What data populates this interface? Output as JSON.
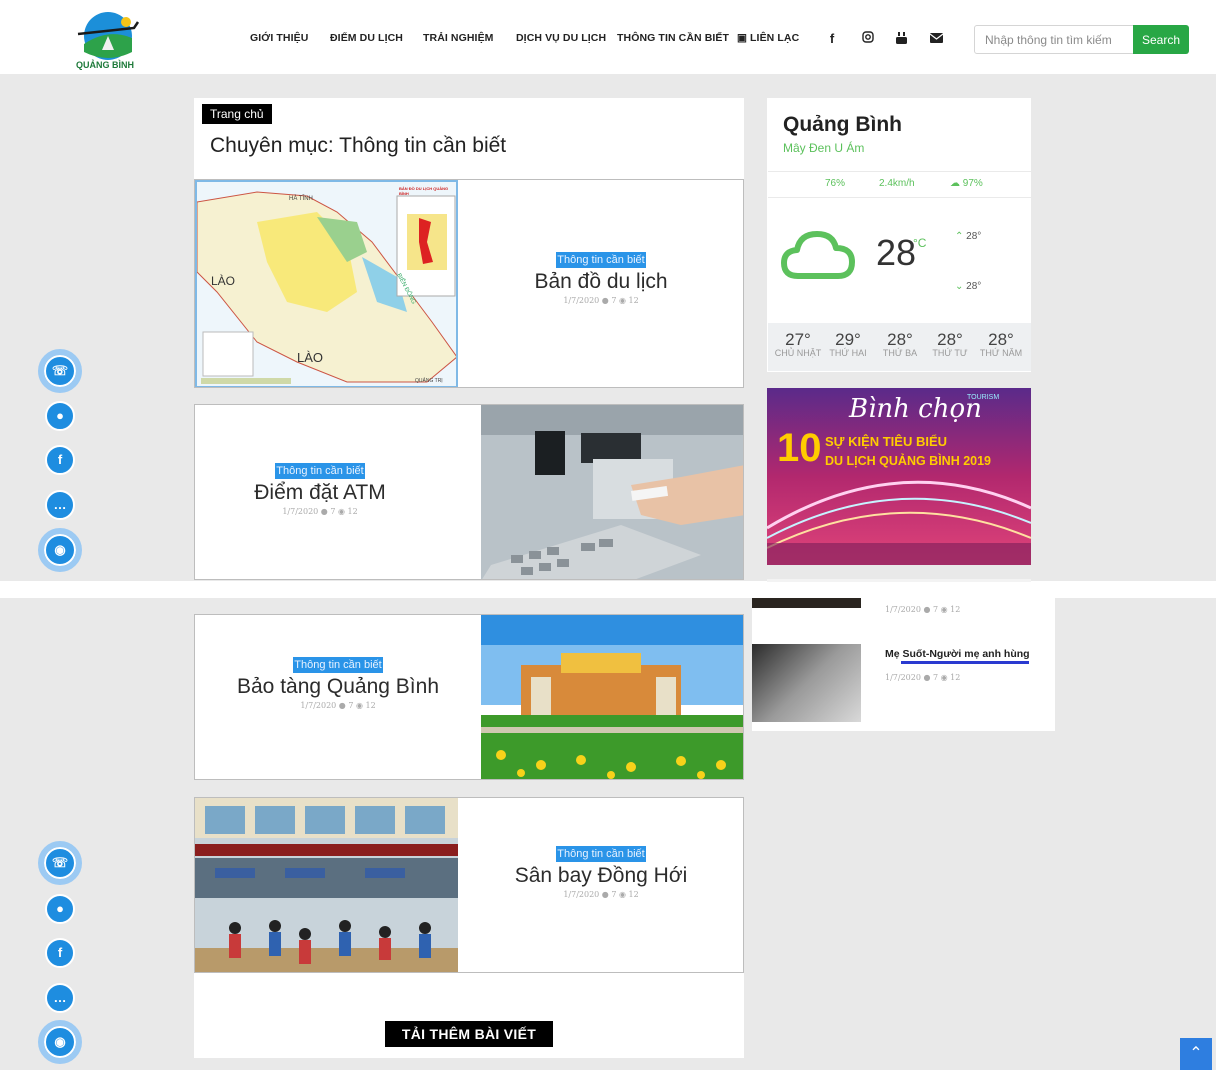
{
  "header": {
    "logo_text": "QUẢNG BÌNH",
    "nav": [
      "GIỚI THIỆU",
      "ĐIỂM DU LỊCH",
      "TRẢI NGHIỆM",
      "DỊCH VỤ DU LỊCH",
      "THÔNG TIN CẦN BIẾT",
      "LIÊN LẠC"
    ],
    "social_icons": [
      "facebook-icon",
      "instagram-icon",
      "youtube-icon",
      "mail-icon"
    ],
    "search_placeholder": "Nhập thông tin tìm kiếm",
    "search_label": "Search"
  },
  "breadcrumb": "Trang chủ",
  "category_title": "Chuyên mục: Thông tin cần biết",
  "articles": [
    {
      "tag": "Thông tin cần biết",
      "title": "Bản đồ du lịch",
      "meta": "1/7/2020 ● 7 ◉ 12"
    },
    {
      "tag": "Thông tin cần biết",
      "title": "Điểm đặt ATM",
      "meta": "1/7/2020 ● 7 ◉ 12"
    },
    {
      "tag": "Thông tin cần biết",
      "title": "Bảo tàng Quảng Bình",
      "meta": "1/7/2020 ● 7 ◉ 12"
    },
    {
      "tag": "Thông tin cần biết",
      "title": "Sân bay Đồng Hới",
      "meta": "1/7/2020 ● 7 ◉ 12"
    }
  ],
  "map_labels": {
    "ha_tinh": "HÀ TĨNH",
    "lao": "LÀO",
    "sea": "BIỂN ĐÔNG",
    "quang_tri": "QUẢNG TRỊ",
    "map_title": "BẢN ĐỒ DU LỊCH QUẢNG BÌNH"
  },
  "load_more": "TẢI THÊM BÀI VIẾT",
  "weather": {
    "city": "Quảng Bình",
    "condition": "Mây Đen U Ám",
    "humidity": "76%",
    "wind": "2.4km/h",
    "cloud": "97%",
    "temp": "28",
    "unit": "°C",
    "high": "28°",
    "low": "28°",
    "forecast": [
      {
        "t": "27°",
        "d": "CHỦ NHẬT"
      },
      {
        "t": "29°",
        "d": "THỨ HAI"
      },
      {
        "t": "28°",
        "d": "THỨ BA"
      },
      {
        "t": "28°",
        "d": "THỨ TƯ"
      },
      {
        "t": "28°",
        "d": "THỨ NĂM"
      }
    ]
  },
  "banner": {
    "line1": "Bình chọn",
    "num": "10",
    "line2": "SỰ KIỆN TIÊU BIỂU",
    "line3": "DU LỊCH QUẢNG BÌNH 2019",
    "logo": "TOURISM"
  },
  "side_posts": [
    {
      "title": "",
      "meta": "1/7/2020 ● 7 ◉ 12"
    },
    {
      "title": "Mẹ Suốt-Người mẹ anh hùng",
      "meta": "1/7/2020 ● 7 ◉ 12"
    }
  ],
  "colors": {
    "accent_green": "#28a745",
    "tag_blue": "#2a94e8",
    "weather_green": "#5cc15c"
  }
}
